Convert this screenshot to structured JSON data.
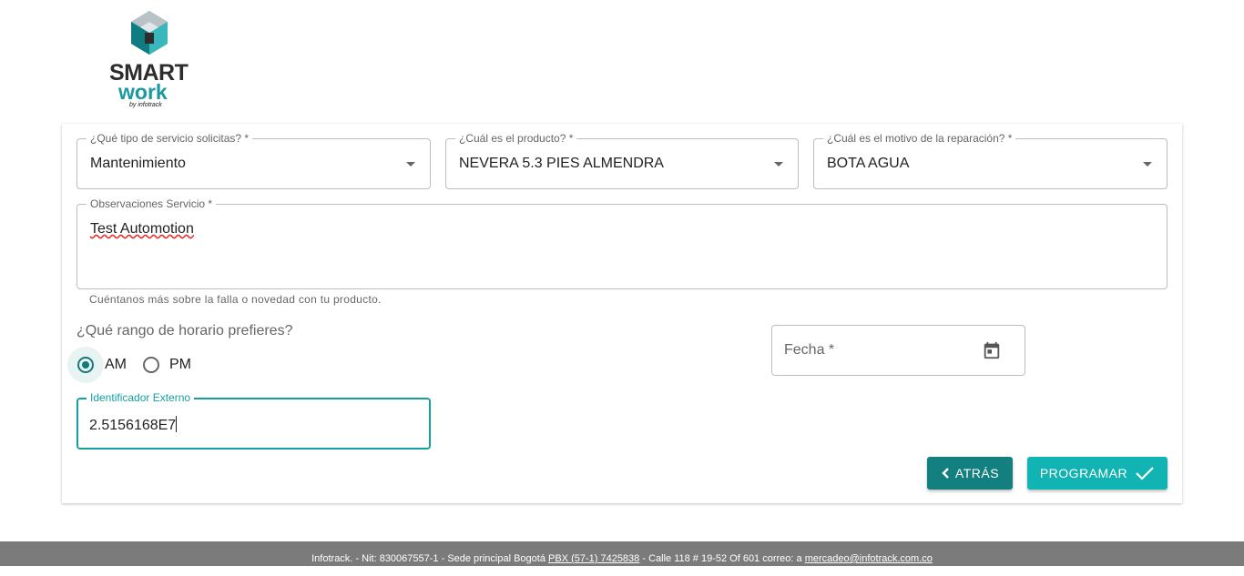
{
  "logo": {
    "line1": "SMART",
    "line2": "work",
    "line3": "by infotrack"
  },
  "form": {
    "service_type": {
      "label": "¿Qué tipo de servicio solicitas? *",
      "value": "Mantenimiento"
    },
    "product": {
      "label": "¿Cuál es el producto? *",
      "value": "NEVERA 5.3 PIES ALMENDRA"
    },
    "reason": {
      "label": "¿Cuál es el motivo de la reparación? *",
      "value": "BOTA AGUA"
    },
    "observations": {
      "label": "Observaciones Servicio *",
      "value": "Test Automotion",
      "helper": "Cuéntanos más sobre la falla o novedad con tu producto."
    },
    "schedule": {
      "question": "¿Qué rango de horario prefieres?",
      "am_label": "AM",
      "pm_label": "PM",
      "selected": "AM"
    },
    "date": {
      "label": "Fecha *"
    },
    "external_id": {
      "label": "Identificador Externo",
      "value": "2.5156168E7"
    }
  },
  "buttons": {
    "back": "ATRÁS",
    "schedule": "PROGRAMAR"
  },
  "footer": {
    "part1": "Infotrack. - Nit: 830067557-1 - Sede principal Bogotá ",
    "pbx": "PBX (57-1) 7425838",
    "part2": " - Calle 118 # 19-52 Of 601   correo: a ",
    "email": "mercadeo@infotrack.com.co"
  },
  "colors": {
    "primary": "#137f7f",
    "accent": "#12b3b3",
    "footer_bg": "#7b7b7b"
  }
}
